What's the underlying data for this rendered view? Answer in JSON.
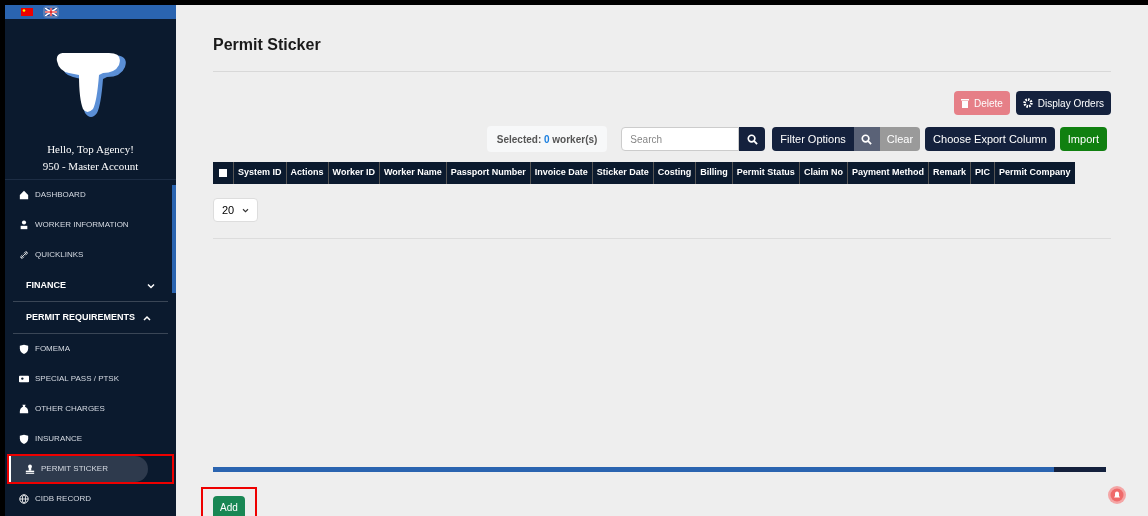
{
  "languages": [
    {
      "selected": false
    },
    {
      "selected": true
    }
  ],
  "greeting": "Hello, Top Agency!",
  "account": "950 - Master Account",
  "menu": [
    {
      "kind": "link",
      "label": "DASHBOARD",
      "selected": false
    },
    {
      "kind": "link",
      "label": "WORKER INFORMATION",
      "selected": false
    },
    {
      "kind": "link",
      "label": "QUICKLINKS",
      "selected": false
    },
    {
      "kind": "section",
      "label": "FINANCE",
      "expanded": false
    },
    {
      "kind": "section",
      "label": "PERMIT REQUIREMENTS",
      "expanded": true
    },
    {
      "kind": "link",
      "label": "FOMEMA",
      "selected": false
    },
    {
      "kind": "link",
      "label": "SPECIAL PASS / PTSK",
      "selected": false
    },
    {
      "kind": "link",
      "label": "OTHER CHARGES",
      "selected": false
    },
    {
      "kind": "link",
      "label": "INSURANCE",
      "selected": false
    },
    {
      "kind": "link",
      "label": "PERMIT STICKER",
      "selected": true
    },
    {
      "kind": "link",
      "label": "CIDB RECORD",
      "selected": false
    }
  ],
  "page_title": "Permit Sticker",
  "toolbar_top": [
    {
      "label": "Delete",
      "kind": "danger",
      "disabled": true
    },
    {
      "label": "Display Orders",
      "kind": "dark",
      "disabled": false
    }
  ],
  "selected_label": "Selected:",
  "selected_count": "0",
  "selected_unit": "worker(s)",
  "search": {
    "placeholder": "Search"
  },
  "filter": {
    "label": "Filter Options",
    "clear": "Clear"
  },
  "toolbar_bottom": [
    {
      "label": "Choose Export Column",
      "kind": "dark"
    },
    {
      "label": "Import",
      "kind": "success"
    }
  ],
  "table": {
    "select_all_checked": false,
    "columns": [
      "System ID",
      "Actions",
      "Worker ID",
      "Worker Name",
      "Passport Number",
      "Invoice Date",
      "Sticker Date",
      "Costing",
      "Billing",
      "Permit Status",
      "Claim No",
      "Payment Method",
      "Remark",
      "PIC",
      "Permit Company"
    ]
  },
  "page_size": "20",
  "add_button": "Add"
}
